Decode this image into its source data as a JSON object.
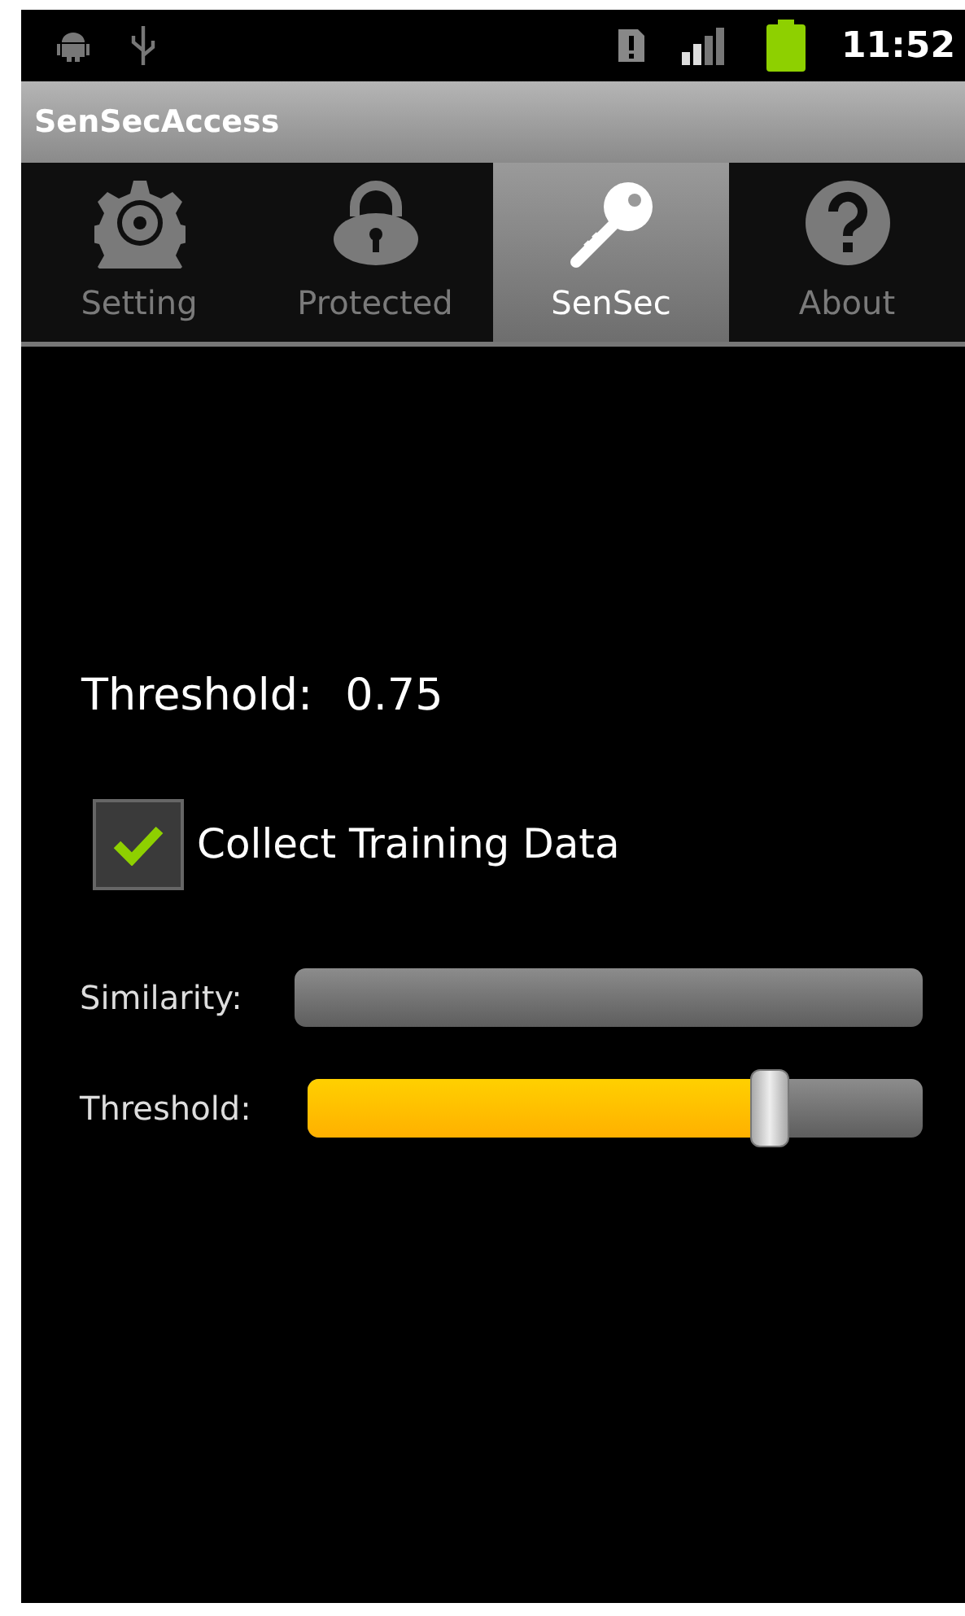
{
  "status_bar": {
    "time": "11:52"
  },
  "app_bar": {
    "title": "SenSecAccess"
  },
  "tabs": [
    {
      "kind": "gear",
      "label": "Setting",
      "selected": false
    },
    {
      "kind": "lock",
      "label": "Protected",
      "selected": false
    },
    {
      "kind": "key",
      "label": "SenSec",
      "selected": true
    },
    {
      "kind": "help",
      "label": "About",
      "selected": false
    }
  ],
  "threshold_display": {
    "label": "Threshold:",
    "value": "0.75"
  },
  "collect_training_data": {
    "label": "Collect Training Data",
    "checked": true
  },
  "meters": [
    {
      "kind": "progress",
      "label": "Similarity:",
      "level": 0
    },
    {
      "kind": "slider",
      "label": "Threshold:",
      "level": 0.75
    }
  ]
}
